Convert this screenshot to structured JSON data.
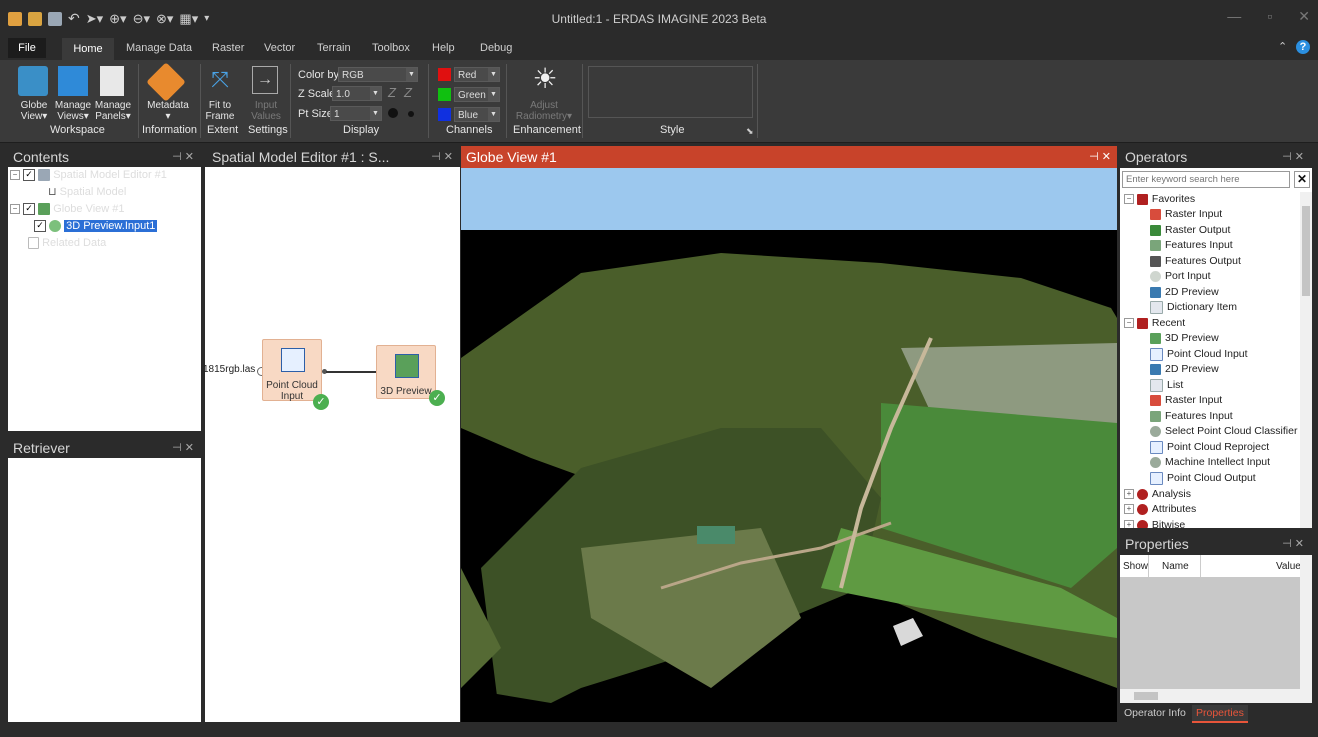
{
  "window": {
    "title": "Untitled:1 - ERDAS IMAGINE 2023 Beta",
    "controls": [
      "—",
      "▫",
      "✕"
    ]
  },
  "tabs": [
    "File",
    "Home",
    "Manage Data",
    "Raster",
    "Vector",
    "Terrain",
    "Toolbox",
    "Help",
    "Debug"
  ],
  "ribbon": {
    "globe_view": "Globe",
    "globe_view2": "View",
    "manage_views": "Manage",
    "manage_views2": "Views",
    "manage_panels": "Manage",
    "manage_panels2": "Panels",
    "metadata": "Metadata",
    "fit_frame1": "Fit to",
    "fit_frame2": "Frame",
    "input_values1": "Input",
    "input_values2": "Values",
    "color_by_label": "Color by",
    "color_by_value": "RGB",
    "z_scale_label": "Z Scale",
    "z_scale_value": "1.0",
    "pt_size_label": "Pt Size",
    "pt_size_value": "1",
    "red": "Red",
    "green": "Green",
    "blue": "Blue",
    "adjust1": "Adjust",
    "adjust2": "Radiometry",
    "groups": {
      "workspace": "Workspace",
      "information": "Information",
      "extent": "Extent",
      "settings": "Settings",
      "display": "Display",
      "channels": "Channels",
      "enhancement": "Enhancement",
      "style": "Style"
    }
  },
  "contents": {
    "title": "Contents",
    "items": [
      "Spatial Model Editor #1",
      "Spatial Model",
      "Globe View #1",
      "3D Preview.Input1",
      "Related Data"
    ]
  },
  "retriever": {
    "title": "Retriever"
  },
  "sme": {
    "title": "Spatial Model Editor #1 : S...",
    "port_label": "1815rgb.las",
    "node1_label1": "Point Cloud",
    "node1_label2": "Input",
    "node2_label": "3D Preview"
  },
  "globe": {
    "title": "Globe View #1"
  },
  "operators": {
    "title": "Operators",
    "search_placeholder": "Enter keyword search here",
    "favorites": "Favorites",
    "favorites_items": [
      "Raster Input",
      "Raster Output",
      "Features Input",
      "Features Output",
      "Port Input",
      "2D Preview",
      "Dictionary Item"
    ],
    "recent": "Recent",
    "recent_items": [
      "3D Preview",
      "Point Cloud Input",
      "2D Preview",
      "List",
      "Raster Input",
      "Features Input",
      "Select Point Cloud Classifier",
      "Point Cloud Reproject",
      "Machine Intellect Input",
      "Point Cloud Output"
    ],
    "analysis": "Analysis",
    "attributes": "Attributes",
    "bitwise": "Bitwise"
  },
  "properties": {
    "title": "Properties",
    "col_show": "Show",
    "col_name": "Name",
    "col_value": "Value"
  },
  "bottom_tabs": [
    "Operator Info",
    "Properties"
  ],
  "colors": {
    "accent": "#c8432a",
    "selection": "#2b6fd6"
  }
}
